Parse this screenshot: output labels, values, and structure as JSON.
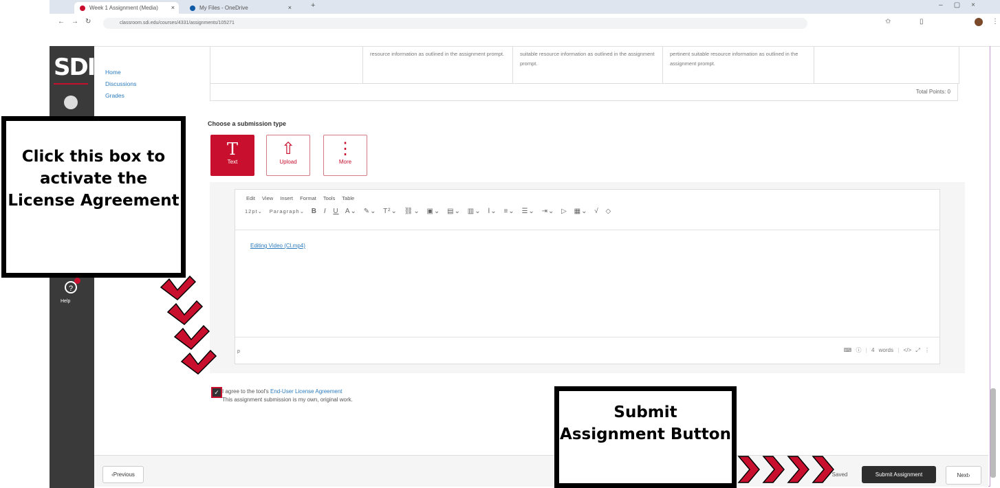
{
  "browser": {
    "tabs": [
      {
        "title": "Week 1 Assignment (Media)",
        "active": true,
        "fav_color": "#c8102e"
      },
      {
        "title": "My Files - OneDrive",
        "active": false,
        "fav_color": "#0f5ba7"
      }
    ],
    "url": "classroom.sdi.edu/courses/4331/assignments/105271"
  },
  "sidebar": {
    "logo": "SDI",
    "help_label": "Help"
  },
  "course_nav": [
    "Home",
    "Discussions",
    "Grades"
  ],
  "rubric": {
    "cells": [
      "resource information as outlined in the assignment prompt.",
      "suitable resource information as outlined in the assignment prompt.",
      "pertinent suitable resource information as outlined in the assignment prompt."
    ],
    "total": "Total Points: 0"
  },
  "submission": {
    "heading": "Choose a submission type",
    "types": [
      {
        "label": "Text",
        "icon": "text-T-icon",
        "selected": true
      },
      {
        "label": "Upload",
        "icon": "upload-icon",
        "selected": false
      },
      {
        "label": "More",
        "icon": "more-vertical-icon",
        "selected": false
      }
    ]
  },
  "editor": {
    "menu": [
      "Edit",
      "View",
      "Insert",
      "Format",
      "Tools",
      "Table"
    ],
    "font_size": "12pt",
    "block_format": "Paragraph",
    "body_link": "Editing Video (Cl.mp4)",
    "status_tag": "p",
    "word_count": "4 words",
    "html_toggle": "</>"
  },
  "agreement": {
    "prefix": "I agree to the tool's ",
    "link": "End-User License Agreement",
    "line2": "This assignment submission is my own, original work."
  },
  "footer": {
    "previous": "Previous",
    "save": "Saved",
    "submit": "Submit Assignment",
    "next": "Next"
  },
  "callouts": {
    "license": "Click this box to activate the License Agreement",
    "submit": "Submit Assignment Button"
  },
  "colors": {
    "brand_red": "#c8102e",
    "dark_rail": "#3a3a3a",
    "link_blue": "#2b7abc"
  }
}
